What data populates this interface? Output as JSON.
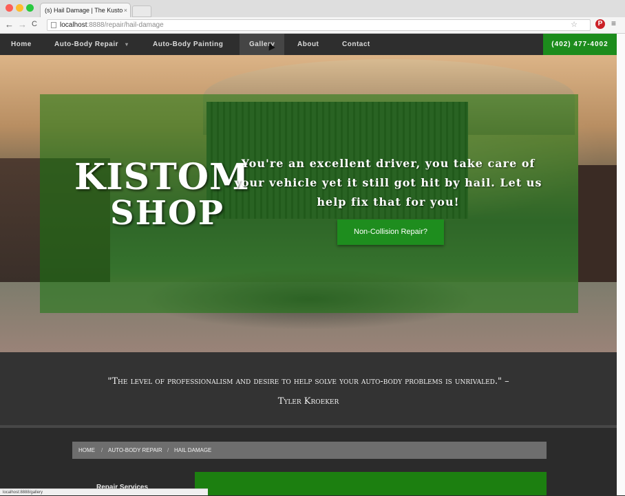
{
  "browser": {
    "tab_title": "(s) Hail Damage | The Kusto",
    "tab_close": "×",
    "url_host": "localhost",
    "url_path": ":8888/repair/hail-damage",
    "status_url": "localhost:8888/gallery",
    "back_icon": "←",
    "forward_icon": "→",
    "reload_icon": "C",
    "star_icon": "☆",
    "pin_icon": "P",
    "menu_icon": "≡"
  },
  "nav": {
    "items": [
      "Home",
      "Auto-Body Repair",
      "Auto-Body Painting",
      "Gallery",
      "About",
      "Contact"
    ],
    "caret": "▾",
    "phone": "(402) 477-4002",
    "active": "Gallery"
  },
  "hero": {
    "logo_line1": "KISTOM",
    "logo_line2": "SHOP",
    "tagline": "You're an excellent driver, you take care of your vehicle yet it still got hit by hail. Let us help fix that for you!",
    "cta": "Non-Collision Repair?"
  },
  "testimonial": {
    "quote": "\"The level of professionalism and desire to help solve your auto-body problems is unrivaled.\" –",
    "author": "Tyler Kroeker"
  },
  "breadcrumb": {
    "items": [
      "HOME",
      "AUTO-BODY REPAIR",
      "HAIL DAMAGE"
    ],
    "sep": "/"
  },
  "sidebar": {
    "heading": "Repair Services"
  },
  "colors": {
    "accent_green": "#1c8c1c",
    "nav_bg": "#2e2e2e",
    "overlay_green": "#187810"
  }
}
